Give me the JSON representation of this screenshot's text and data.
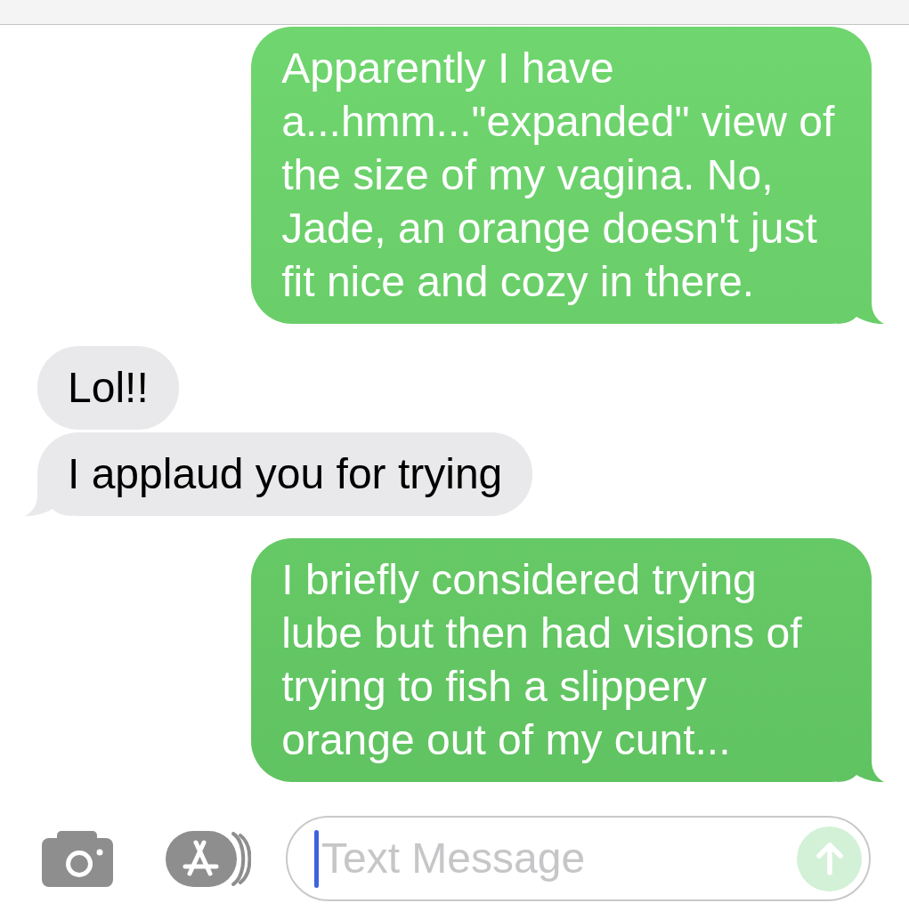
{
  "messages": [
    {
      "kind": "sent",
      "text": "Apparently I have a...hmm...\"expanded\" view of the size of my vagina. No, Jade, an orange doesn't just fit nice and cozy in there.",
      "tail": true
    },
    {
      "kind": "received",
      "text": "Lol!!",
      "tail": false
    },
    {
      "kind": "received",
      "text": "I applaud you for trying",
      "tail": true
    },
    {
      "kind": "sent",
      "text": "I briefly considered trying lube but then had visions of trying to fish a slippery orange out of my cunt...",
      "tail": true
    }
  ],
  "composer": {
    "placeholder": "Text Message",
    "focused": true,
    "send_button": {
      "disabled": true
    }
  }
}
